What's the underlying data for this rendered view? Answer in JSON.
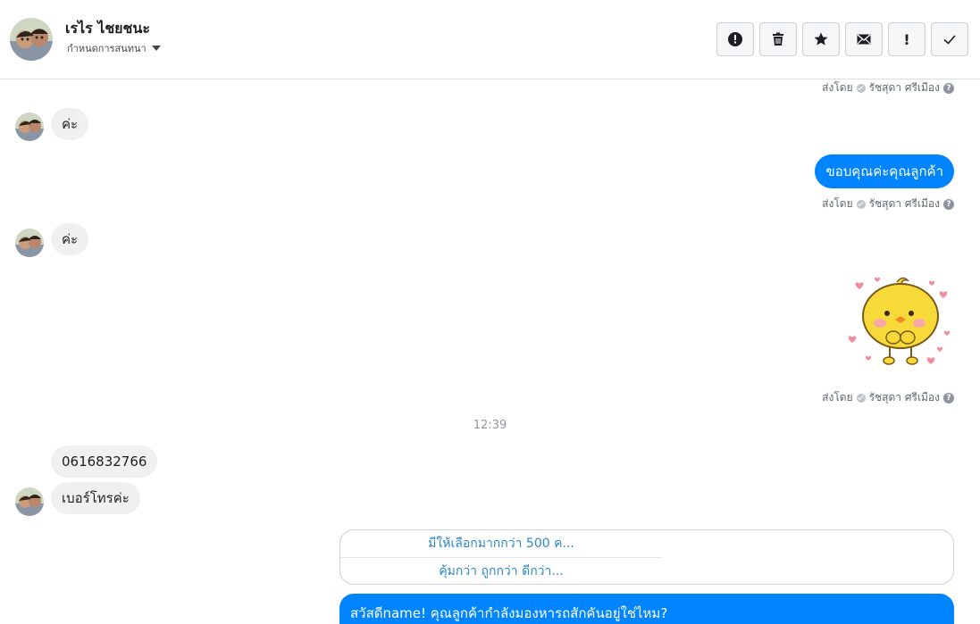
{
  "header": {
    "contact_name": "เรไร ไชยชนะ",
    "assign_label": "กำหนดการสนทนา",
    "actions": [
      {
        "name": "spam-icon"
      },
      {
        "name": "trash-icon"
      },
      {
        "name": "star-icon"
      },
      {
        "name": "mail-icon"
      },
      {
        "name": "important-icon",
        "glyph": "!"
      },
      {
        "name": "done-icon"
      }
    ]
  },
  "messages": {
    "sent_by_label": "ส่งโดย",
    "sender_name": "รัชสุดา ศรีเมือง",
    "help_glyph": "?",
    "in1": "ค่ะ",
    "out1": "ขอบคุณค่ะคุณลูกค้า",
    "in2": "ค่ะ",
    "timestamp": "12:39",
    "in3": "0616832766",
    "in4": "เบอร์โทรค่ะ",
    "quick_replies": [
      "มีให้เลือกมากกว่า 500 ค...",
      "คุ้มกว่า ถูกกว่า ดีกว่า..."
    ],
    "out_card_text": "สวัสดีname! คุณลูกค้ากำลังมองหารถสักคันอยู่ใช่ไหม?"
  },
  "colors": {
    "outgoing_bubble": "#0084ff",
    "incoming_bubble": "#f0f0f0",
    "quick_reply_text": "#2d88c9"
  }
}
